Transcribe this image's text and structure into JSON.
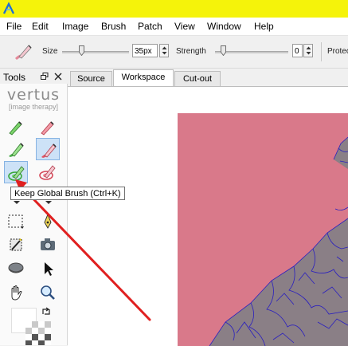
{
  "colors": {
    "title_bar": "#f5f30a",
    "canvas_pink": "#d9798a",
    "annotation_arrow": "#e02020",
    "selection_outline": "#2a1fbf"
  },
  "menu": {
    "items": [
      "File",
      "Edit",
      "Image",
      "Brush",
      "Patch",
      "View",
      "Window",
      "Help"
    ]
  },
  "toolbar": {
    "brush_icon": "brush-icon",
    "size_label": "Size",
    "size_value": "35px",
    "strength_label": "Strength",
    "strength_value": "0",
    "protect_label": "Protec"
  },
  "tools_panel": {
    "title": "Tools",
    "logo_main": "vertus",
    "logo_sub": "[image therapy]",
    "tools": [
      {
        "icon": "green-brush-icon"
      },
      {
        "icon": "red-brush-icon"
      },
      {
        "icon": "green-smart-brush-icon"
      },
      {
        "icon": "red-smart-brush-icon"
      },
      {
        "icon": "keep-global-brush-icon"
      },
      {
        "icon": "remove-global-brush-icon"
      },
      {
        "icon": "rectangle-select-icon"
      },
      {
        "icon": "pen-select-icon"
      },
      {
        "icon": "magic-wand-icon"
      },
      {
        "icon": "fill-icon"
      },
      {
        "icon": "camera-icon"
      },
      {
        "icon": "eraser-icon"
      },
      {
        "icon": "pointer-icon"
      },
      {
        "icon": "hand-icon"
      },
      {
        "icon": "zoom-icon"
      },
      {
        "icon": "swap-colors-icon"
      }
    ]
  },
  "tabs": [
    {
      "label": "Source",
      "active": false
    },
    {
      "label": "Workspace",
      "active": true
    },
    {
      "label": "Cut-out",
      "active": false
    }
  ],
  "tooltip": {
    "text": "Keep Global Brush (Ctrl+K)"
  }
}
